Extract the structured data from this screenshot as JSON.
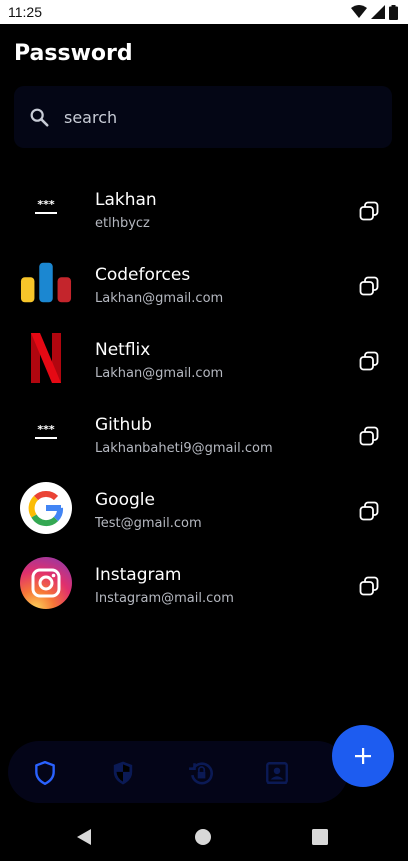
{
  "status_bar": {
    "time": "11:25"
  },
  "header": {
    "title": "Password"
  },
  "search": {
    "placeholder": "search"
  },
  "entries": [
    {
      "title": "Lakhan",
      "subtitle": "etlhbycz",
      "icon": "password-dots-icon"
    },
    {
      "title": "Codeforces",
      "subtitle": "Lakhan@gmail.com",
      "icon": "codeforces-logo"
    },
    {
      "title": "Netflix",
      "subtitle": "Lakhan@gmail.com",
      "icon": "netflix-logo"
    },
    {
      "title": "Github",
      "subtitle": "Lakhanbaheti9@gmail.com",
      "icon": "password-dots-icon"
    },
    {
      "title": "Google",
      "subtitle": "Test@gmail.com",
      "icon": "google-logo"
    },
    {
      "title": "Instagram",
      "subtitle": "Instagram@mail.com",
      "icon": "instagram-logo"
    }
  ],
  "bottom_nav": {
    "items": [
      "shield-outline-icon",
      "shield-half-icon",
      "history-lock-icon",
      "contact-card-icon"
    ],
    "active_index": 0
  },
  "colors": {
    "background": "#000000",
    "accent": "#1d5cf0",
    "search_bg": "#040615",
    "subtitle": "#b5b8c0"
  }
}
